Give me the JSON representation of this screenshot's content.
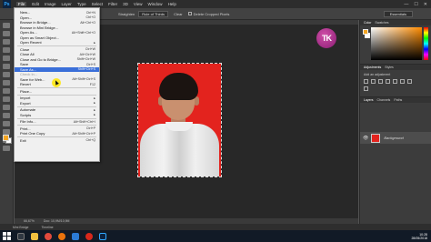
{
  "app": {
    "logo": "Ps",
    "window_controls": [
      "—",
      "☐",
      "✕"
    ]
  },
  "menubar": {
    "items": [
      "File",
      "Edit",
      "Image",
      "Layer",
      "Type",
      "Select",
      "Filter",
      "3D",
      "View",
      "Window",
      "Help"
    ]
  },
  "options_bar": {
    "straighten": "Straighten",
    "clear": "Clear",
    "rule": "Rule of Thirds",
    "delete_cropped": "Delete Cropped Pixels",
    "workspace": "Essentials"
  },
  "badge": {
    "text": "TK"
  },
  "file_menu": {
    "items": [
      {
        "label": "New...",
        "shortcut": "Ctrl+N",
        "state": "normal"
      },
      {
        "label": "Open...",
        "shortcut": "Ctrl+O",
        "state": "normal"
      },
      {
        "label": "Browse in Bridge...",
        "shortcut": "Alt+Ctrl+O",
        "state": "normal"
      },
      {
        "label": "Browse in Mini Bridge...",
        "shortcut": "",
        "state": "normal"
      },
      {
        "label": "Open As...",
        "shortcut": "Alt+Shift+Ctrl+O",
        "state": "normal"
      },
      {
        "label": "Open as Smart Object...",
        "shortcut": "",
        "state": "normal"
      },
      {
        "label": "Open Recent",
        "shortcut": "",
        "state": "submenu"
      },
      {
        "sep": true
      },
      {
        "label": "Close",
        "shortcut": "Ctrl+W",
        "state": "normal"
      },
      {
        "label": "Close All",
        "shortcut": "Alt+Ctrl+W",
        "state": "normal"
      },
      {
        "label": "Close and Go to Bridge...",
        "shortcut": "Shift+Ctrl+W",
        "state": "normal"
      },
      {
        "label": "Save",
        "shortcut": "Ctrl+S",
        "state": "normal"
      },
      {
        "label": "Save As...",
        "shortcut": "Shift+Ctrl+S",
        "state": "highlight"
      },
      {
        "label": "Check In...",
        "shortcut": "",
        "state": "disabled"
      },
      {
        "label": "Save for Web...",
        "shortcut": "Alt+Shift+Ctrl+S",
        "state": "normal"
      },
      {
        "label": "Revert",
        "shortcut": "F12",
        "state": "normal"
      },
      {
        "sep": true
      },
      {
        "label": "Place...",
        "shortcut": "",
        "state": "normal"
      },
      {
        "sep": true
      },
      {
        "label": "Import",
        "shortcut": "",
        "state": "submenu"
      },
      {
        "label": "Export",
        "shortcut": "",
        "state": "submenu"
      },
      {
        "sep": true
      },
      {
        "label": "Automate",
        "shortcut": "",
        "state": "submenu"
      },
      {
        "label": "Scripts",
        "shortcut": "",
        "state": "submenu"
      },
      {
        "sep": true
      },
      {
        "label": "File Info...",
        "shortcut": "Alt+Shift+Ctrl+I",
        "state": "normal"
      },
      {
        "sep": true
      },
      {
        "label": "Print...",
        "shortcut": "Ctrl+P",
        "state": "normal"
      },
      {
        "label": "Print One Copy",
        "shortcut": "Alt+Shift+Ctrl+P",
        "state": "normal"
      },
      {
        "sep": true
      },
      {
        "label": "Exit",
        "shortcut": "Ctrl+Q",
        "state": "normal"
      }
    ]
  },
  "status": {
    "zoom": "66,67%",
    "doc": "Doc: 10,9M/10,9M"
  },
  "bottom_tabs": [
    "Mini Bridge",
    "Timeline"
  ],
  "panels": {
    "color_tabs": [
      "Color",
      "Swatches"
    ],
    "adj_tabs": [
      "Adjustments",
      "Styles"
    ],
    "adj_label": "Add an adjustment",
    "layer_tabs": [
      "Layers",
      "Channels",
      "Paths"
    ],
    "layer_name": "Background"
  },
  "taskbar": {
    "time": "10:28",
    "date": "28/05/2018"
  },
  "colors": {
    "foreground": "#f5a623",
    "photo_bg": "#e3231e",
    "menu_highlight": "#3a6fd9"
  }
}
